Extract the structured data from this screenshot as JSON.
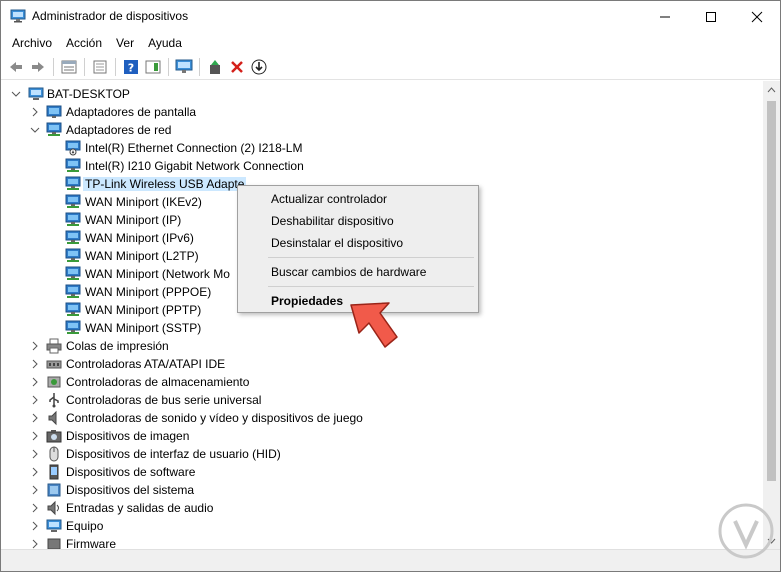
{
  "window": {
    "title": "Administrador de dispositivos"
  },
  "menu": [
    "Archivo",
    "Acción",
    "Ver",
    "Ayuda"
  ],
  "toolbar": {
    "icons": [
      "back-arrow-icon",
      "forward-arrow-icon",
      "properties-list-icon",
      "properties-icon",
      "help-icon",
      "action-pane-icon",
      "monitor-icon",
      "update-driver-icon",
      "uninstall-icon",
      "scan-download-icon"
    ]
  },
  "tree": {
    "root": "BAT-DESKTOP",
    "categories_top": [
      {
        "label": "Adaptadores de pantalla",
        "expanded": false
      },
      {
        "label": "Adaptadores de red",
        "expanded": true
      }
    ],
    "network_adapters": [
      "Intel(R) Ethernet Connection (2) I218-LM",
      "Intel(R) I210 Gigabit Network Connection",
      "TP-Link Wireless USB Adapter",
      "WAN Miniport (IKEv2)",
      "WAN Miniport (IP)",
      "WAN Miniport (IPv6)",
      "WAN Miniport (L2TP)",
      "WAN Miniport (Network Mo",
      "WAN Miniport (PPPOE)",
      "WAN Miniport (PPTP)",
      "WAN Miniport (SSTP)"
    ],
    "selected_adapter_label": "TP-Link Wireless USB Adapte",
    "categories_bottom": [
      "Colas de impresión",
      "Controladoras ATA/ATAPI IDE",
      "Controladoras de almacenamiento",
      "Controladoras de bus serie universal",
      "Controladoras de sonido y vídeo y dispositivos de juego",
      "Dispositivos de imagen",
      "Dispositivos de interfaz de usuario (HID)",
      "Dispositivos de software",
      "Dispositivos del sistema",
      "Entradas y salidas de audio",
      "Equipo",
      "Firmware"
    ]
  },
  "context_menu": {
    "update": "Actualizar controlador",
    "disable": "Deshabilitar dispositivo",
    "uninstall": "Desinstalar el dispositivo",
    "scan": "Buscar cambios de hardware",
    "properties": "Propiedades"
  },
  "colors": {
    "selection": "#cce8ff",
    "arrow": "#f15a4a",
    "accent_blue": "#2b7bd6"
  }
}
